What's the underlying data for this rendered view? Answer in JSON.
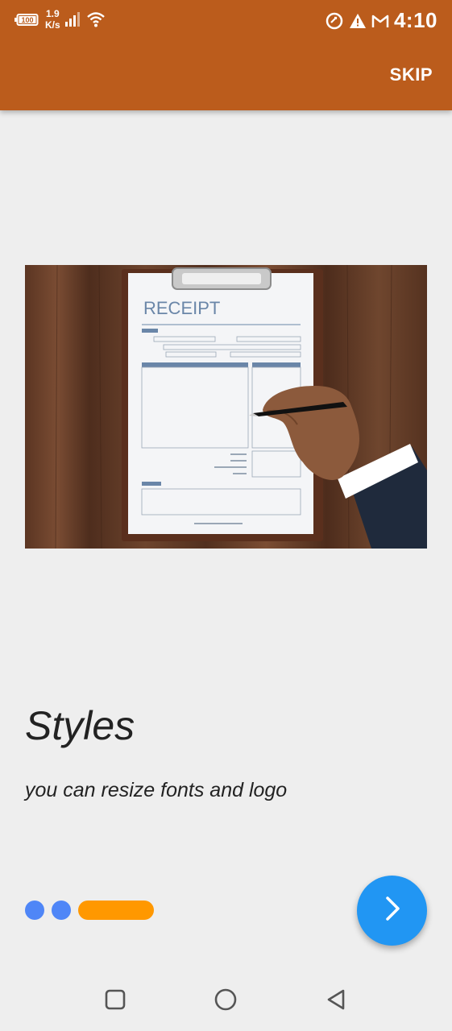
{
  "status_bar": {
    "battery_level": "100",
    "net_speed_value": "1.9",
    "net_speed_unit": "K/s",
    "time": "4:10"
  },
  "app_bar": {
    "skip_label": "SKIP"
  },
  "illustration": {
    "receipt_heading": "RECEIPT"
  },
  "content": {
    "title": "Styles",
    "subtitle": "you can resize fonts and logo"
  },
  "pager": {
    "total": 3,
    "active_index": 2
  },
  "colors": {
    "app_bar": "#bb5c1c",
    "dot": "#4f86f7",
    "active_dot": "#ff9800",
    "fab": "#2196f3",
    "background": "#eeeeee"
  },
  "icons": {
    "fab": "chevron-right-icon",
    "nav_recent": "square-icon",
    "nav_home": "circle-icon",
    "nav_back": "triangle-back-icon"
  }
}
